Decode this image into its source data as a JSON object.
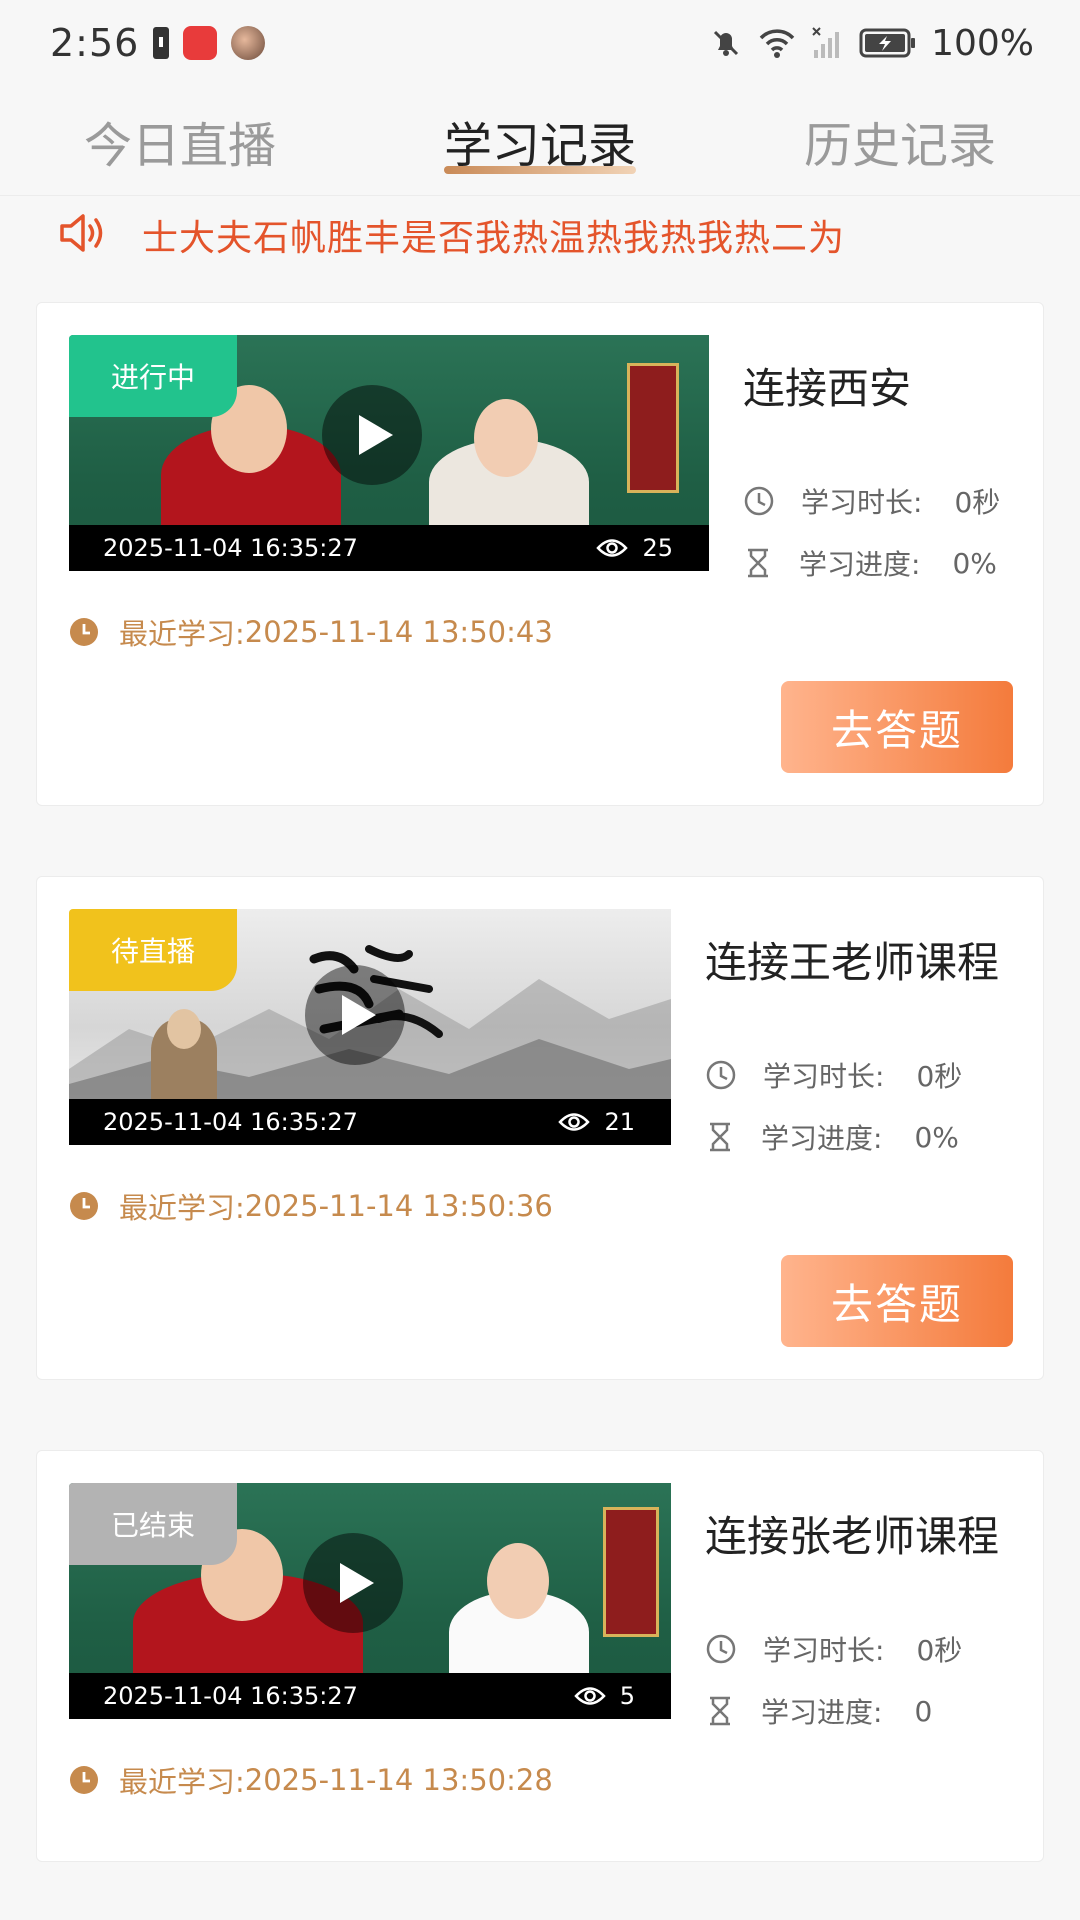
{
  "status_bar": {
    "time": "2:56",
    "battery_percent": "100%",
    "icons": [
      "battery-small-icon",
      "app-icon",
      "avatar-icon",
      "mute-bell-icon",
      "wifi-icon",
      "no-signal-icon",
      "battery-charging-icon"
    ]
  },
  "tabs": [
    {
      "label": "今日直播",
      "active": false
    },
    {
      "label": "学习记录",
      "active": true
    },
    {
      "label": "历史记录",
      "active": false
    }
  ],
  "notice": {
    "icon": "speaker-icon",
    "text": "士大夫石帆胜丰是否我热温热我热我热二为"
  },
  "labels": {
    "duration": "学习时长:",
    "progress": "学习进度:",
    "recent_prefix": "最近学习:",
    "answer_button": "去答题"
  },
  "courses": [
    {
      "status": "进行中",
      "title": "连接西安",
      "date": "2025-11-04 16:35:27",
      "views": "25",
      "duration": "0秒",
      "progress": "0%",
      "recent": "2025-11-14 13:50:43"
    },
    {
      "status": "待直播",
      "title": "连接王老师课程",
      "date": "2025-11-04 16:35:27",
      "views": "21",
      "duration": "0秒",
      "progress": "0%",
      "recent": "2025-11-14 13:50:36"
    },
    {
      "status": "已结束",
      "title": "连接张老师课程",
      "date": "2025-11-04 16:35:27",
      "views": "5",
      "duration": "0秒",
      "progress": "0",
      "recent": "2025-11-14 13:50:28"
    }
  ],
  "colors": {
    "accent_orange": "#f47b3c",
    "notice_red": "#e4542b",
    "recent_gold": "#c68a4d",
    "tag_green": "#22c38d",
    "tag_yellow": "#f1c21c",
    "tag_grey": "#b3b3b3"
  }
}
